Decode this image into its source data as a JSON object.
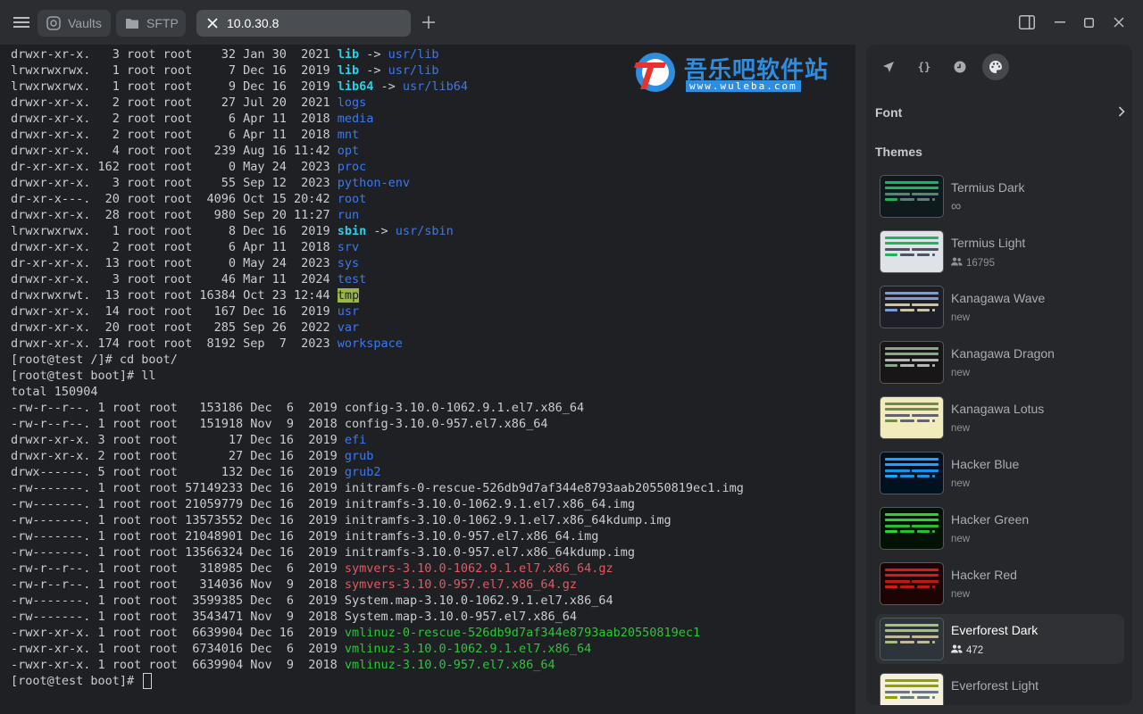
{
  "tabs": [
    {
      "label": "Vaults",
      "icon": "vault-icon"
    },
    {
      "label": "SFTP",
      "icon": "folder-icon"
    },
    {
      "label": "10.0.30.8",
      "icon": "close-icon",
      "active": true
    }
  ],
  "watermark": {
    "title": "吾乐吧软件站",
    "url": "www.wuleba.com"
  },
  "terminal": {
    "lines": [
      [
        {
          "t": "drwxr-xr-x.   3 root root    32 Jan 30  2021 "
        },
        {
          "t": "lib",
          "c": "c-link"
        },
        {
          "t": " -> ",
          "c": "c-arrow"
        },
        {
          "t": "usr/lib",
          "c": "c-dir"
        }
      ],
      [
        {
          "t": "lrwxrwxrwx.   1 root root     7 Dec 16  2019 "
        },
        {
          "t": "lib",
          "c": "c-link"
        },
        {
          "t": " -> ",
          "c": "c-arrow"
        },
        {
          "t": "usr/lib",
          "c": "c-dir"
        }
      ],
      [
        {
          "t": "lrwxrwxrwx.   1 root root     9 Dec 16  2019 "
        },
        {
          "t": "lib64",
          "c": "c-link"
        },
        {
          "t": " -> ",
          "c": "c-arrow"
        },
        {
          "t": "usr/lib64",
          "c": "c-dir"
        }
      ],
      [
        {
          "t": "drwxr-xr-x.   2 root root    27 Jul 20  2021 "
        },
        {
          "t": "logs",
          "c": "c-dir"
        }
      ],
      [
        {
          "t": "drwxr-xr-x.   2 root root     6 Apr 11  2018 "
        },
        {
          "t": "media",
          "c": "c-dir"
        }
      ],
      [
        {
          "t": "drwxr-xr-x.   2 root root     6 Apr 11  2018 "
        },
        {
          "t": "mnt",
          "c": "c-dir"
        }
      ],
      [
        {
          "t": "drwxr-xr-x.   4 root root   239 Aug 16 11:42 "
        },
        {
          "t": "opt",
          "c": "c-dir"
        }
      ],
      [
        {
          "t": "dr-xr-xr-x. 162 root root     0 May 24  2023 "
        },
        {
          "t": "proc",
          "c": "c-dir"
        }
      ],
      [
        {
          "t": "drwxr-xr-x.   3 root root    55 Sep 12  2023 "
        },
        {
          "t": "python-env",
          "c": "c-dir"
        }
      ],
      [
        {
          "t": "dr-xr-x---.  20 root root  4096 Oct 15 20:42 "
        },
        {
          "t": "root",
          "c": "c-dir"
        }
      ],
      [
        {
          "t": "drwxr-xr-x.  28 root root   980 Sep 20 11:27 "
        },
        {
          "t": "run",
          "c": "c-dir"
        }
      ],
      [
        {
          "t": "lrwxrwxrwx.   1 root root     8 Dec 16  2019 "
        },
        {
          "t": "sbin",
          "c": "c-link"
        },
        {
          "t": " -> ",
          "c": "c-arrow"
        },
        {
          "t": "usr/sbin",
          "c": "c-dir"
        }
      ],
      [
        {
          "t": "drwxr-xr-x.   2 root root     6 Apr 11  2018 "
        },
        {
          "t": "srv",
          "c": "c-dir"
        }
      ],
      [
        {
          "t": "dr-xr-xr-x.  13 root root     0 May 24  2023 "
        },
        {
          "t": "sys",
          "c": "c-dir"
        }
      ],
      [
        {
          "t": "drwxr-xr-x.   3 root root    46 Mar 11  2024 "
        },
        {
          "t": "test",
          "c": "c-dir"
        }
      ],
      [
        {
          "t": "drwxrwxrwt.  13 root root 16384 Oct 23 12:44 "
        },
        {
          "t": "tmp",
          "c": "c-tmp"
        }
      ],
      [
        {
          "t": "drwxr-xr-x.  14 root root   167 Dec 16  2019 "
        },
        {
          "t": "usr",
          "c": "c-dir"
        }
      ],
      [
        {
          "t": "drwxr-xr-x.  20 root root   285 Sep 26  2022 "
        },
        {
          "t": "var",
          "c": "c-dir"
        }
      ],
      [
        {
          "t": "drwxr-xr-x. 174 root root  8192 Sep  7  2023 "
        },
        {
          "t": "workspace",
          "c": "c-dir"
        }
      ],
      [
        {
          "t": "[root@test /]# cd boot/"
        }
      ],
      [
        {
          "t": "[root@test boot]# ll"
        }
      ],
      [
        {
          "t": "total 150904"
        }
      ],
      [
        {
          "t": "-rw-r--r--. 1 root root   153186 Dec  6  2019 config-3.10.0-1062.9.1.el7.x86_64"
        }
      ],
      [
        {
          "t": "-rw-r--r--. 1 root root   151918 Nov  9  2018 config-3.10.0-957.el7.x86_64"
        }
      ],
      [
        {
          "t": "drwxr-xr-x. 3 root root       17 Dec 16  2019 "
        },
        {
          "t": "efi",
          "c": "c-dir"
        }
      ],
      [
        {
          "t": "drwxr-xr-x. 2 root root       27 Dec 16  2019 "
        },
        {
          "t": "grub",
          "c": "c-dir"
        }
      ],
      [
        {
          "t": "drwx------. 5 root root      132 Dec 16  2019 "
        },
        {
          "t": "grub2",
          "c": "c-dir"
        }
      ],
      [
        {
          "t": "-rw-------. 1 root root 57149233 Dec 16  2019 initramfs-0-rescue-526db9d7af344e8793aab20550819ec1.img"
        }
      ],
      [
        {
          "t": "-rw-------. 1 root root 21059779 Dec 16  2019 initramfs-3.10.0-1062.9.1.el7.x86_64.img"
        }
      ],
      [
        {
          "t": "-rw-------. 1 root root 13573552 Dec 16  2019 initramfs-3.10.0-1062.9.1.el7.x86_64kdump.img"
        }
      ],
      [
        {
          "t": "-rw-------. 1 root root 21048901 Dec 16  2019 initramfs-3.10.0-957.el7.x86_64.img"
        }
      ],
      [
        {
          "t": "-rw-------. 1 root root 13566324 Dec 16  2019 initramfs-3.10.0-957.el7.x86_64kdump.img"
        }
      ],
      [
        {
          "t": "-rw-r--r--. 1 root root   318985 Dec  6  2019 "
        },
        {
          "t": "symvers-3.10.0-1062.9.1.el7.x86_64.gz",
          "c": "c-red"
        }
      ],
      [
        {
          "t": "-rw-r--r--. 1 root root   314036 Nov  9  2018 "
        },
        {
          "t": "symvers-3.10.0-957.el7.x86_64.gz",
          "c": "c-red"
        }
      ],
      [
        {
          "t": "-rw-------. 1 root root  3599385 Dec  6  2019 System.map-3.10.0-1062.9.1.el7.x86_64"
        }
      ],
      [
        {
          "t": "-rw-------. 1 root root  3543471 Nov  9  2018 System.map-3.10.0-957.el7.x86_64"
        }
      ],
      [
        {
          "t": "-rwxr-xr-x. 1 root root  6639904 Dec 16  2019 "
        },
        {
          "t": "vmlinuz-0-rescue-526db9d7af344e8793aab20550819ec1",
          "c": "c-green"
        }
      ],
      [
        {
          "t": "-rwxr-xr-x. 1 root root  6734016 Dec  6  2019 "
        },
        {
          "t": "vmlinuz-3.10.0-1062.9.1.el7.x86_64",
          "c": "c-green"
        }
      ],
      [
        {
          "t": "-rwxr-xr-x. 1 root root  6639904 Nov  9  2018 "
        },
        {
          "t": "vmlinuz-3.10.0-957.el7.x86_64",
          "c": "c-green"
        }
      ]
    ],
    "prompt": "[root@test boot]# "
  },
  "panel": {
    "icon_tabs": [
      "rocket-icon",
      "braces-icon",
      "history-icon",
      "palette-icon"
    ],
    "font_label": "Font",
    "themes_label": "Themes",
    "themes": [
      {
        "name": "Termius Dark",
        "sub": "∞",
        "people": false,
        "bg": "#0e1a1e",
        "accent": "#21b35a",
        "fg": "#6a8a82",
        "selected": false
      },
      {
        "name": "Termius Light",
        "sub": "16795",
        "people": true,
        "bg": "#dfe3e8",
        "accent": "#21b35a",
        "fg": "#3c4452",
        "selected": false
      },
      {
        "name": "Kanagawa Wave",
        "sub": "new",
        "people": false,
        "bg": "#1f1f28",
        "accent": "#7e9cd8",
        "fg": "#dcd7ba",
        "selected": false
      },
      {
        "name": "Kanagawa Dragon",
        "sub": "new",
        "people": false,
        "bg": "#181616",
        "accent": "#87a987",
        "fg": "#c5c9c5",
        "selected": false
      },
      {
        "name": "Kanagawa Lotus",
        "sub": "new",
        "people": false,
        "bg": "#f2ecbc",
        "accent": "#6f894e",
        "fg": "#545464",
        "selected": false
      },
      {
        "name": "Hacker Blue",
        "sub": "new",
        "people": false,
        "bg": "#02101f",
        "accent": "#1aa3ff",
        "fg": "#1aa3ff",
        "selected": false
      },
      {
        "name": "Hacker Green",
        "sub": "new",
        "people": false,
        "bg": "#031204",
        "accent": "#2fd12f",
        "fg": "#2fd12f",
        "selected": false
      },
      {
        "name": "Hacker Red",
        "sub": "new",
        "people": false,
        "bg": "#1d0404",
        "accent": "#d41a1a",
        "fg": "#d41a1a",
        "selected": false
      },
      {
        "name": "Everforest Dark",
        "sub": "472",
        "people": true,
        "bg": "#2d353b",
        "accent": "#a7c080",
        "fg": "#d3c6aa",
        "selected": true
      },
      {
        "name": "Everforest Light",
        "sub": "",
        "people": false,
        "bg": "#f4f0d9",
        "accent": "#8da101",
        "fg": "#5c6a72",
        "selected": false
      }
    ]
  }
}
